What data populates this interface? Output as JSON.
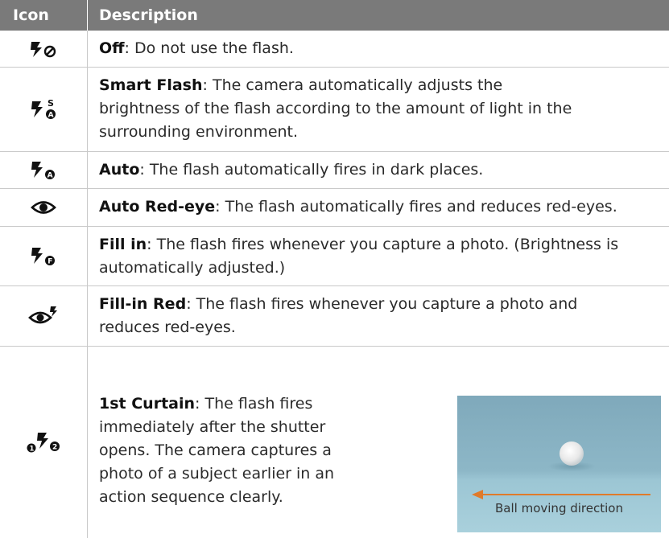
{
  "header": {
    "icon_col": "Icon",
    "desc_col": "Description"
  },
  "rows": [
    {
      "icon": "flash-off-icon",
      "term": "Off",
      "text": ": Do not use the flash."
    },
    {
      "icon": "smart-flash-icon",
      "term": "Smart Flash",
      "text": ": The camera automatically adjusts the brightness of the flash according to the amount of light in the surrounding environment."
    },
    {
      "icon": "flash-auto-icon",
      "term": "Auto",
      "text": ": The flash automatically fires in dark places."
    },
    {
      "icon": "auto-red-eye-icon",
      "term": "Auto Red-eye",
      "text": ": The flash automatically fires and reduces red-eyes."
    },
    {
      "icon": "fill-in-flash-icon",
      "term": "Fill in",
      "text": ": The flash fires whenever you capture a photo. (Brightness is automatically adjusted.)"
    },
    {
      "icon": "fill-in-red-eye-icon",
      "term": "Fill-in Red",
      "text": ": The flash fires whenever you capture a photo and reduces red-eyes."
    },
    {
      "icon": "first-curtain-icon",
      "term": "1st Curtain",
      "text": ": The flash fires immediately after the shutter opens. The camera captures a photo of a subject earlier in an action sequence clearly."
    }
  ],
  "photo": {
    "caption": "Ball moving direction",
    "arrow_color": "#e07a2a",
    "background_color": "#8ab4c4"
  }
}
